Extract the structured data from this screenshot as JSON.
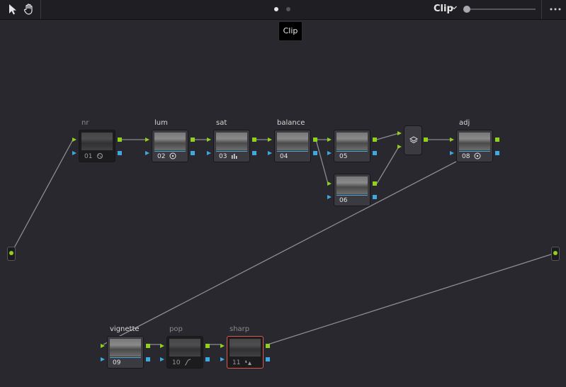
{
  "toolbar": {
    "mode_label": "Clip",
    "tools": [
      "pointer-tool",
      "hand-tool"
    ]
  },
  "tooltip": "Clip",
  "colors": {
    "rgb_port": "#8fd11c",
    "key_port": "#3fa8e0",
    "wire": "#8c8c92",
    "selected_outline": "#e0564a"
  },
  "nodes": [
    {
      "id": "01",
      "label": "nr",
      "icon": "noise-reduction-icon",
      "state": "disabled"
    },
    {
      "id": "02",
      "label": "lum",
      "icon": "color-wheels-icon",
      "state": "normal"
    },
    {
      "id": "03",
      "label": "sat",
      "icon": "levels-icon",
      "state": "normal"
    },
    {
      "id": "04",
      "label": "balance",
      "icon": "",
      "state": "normal"
    },
    {
      "id": "05",
      "label": "",
      "icon": "",
      "state": "normal"
    },
    {
      "id": "06",
      "label": "",
      "icon": "",
      "state": "normal"
    },
    {
      "id": "08",
      "label": "adj",
      "icon": "color-wheels-icon",
      "state": "normal"
    },
    {
      "id": "09",
      "label": "vignette",
      "icon": "",
      "state": "normal"
    },
    {
      "id": "10",
      "label": "pop",
      "icon": "curves-icon",
      "state": "disabled"
    },
    {
      "id": "11",
      "label": "sharp",
      "icon": "sharpen-icon",
      "state": "disabled-selected"
    }
  ],
  "layer_mixer": {
    "icon": "layer-mixer-icon"
  }
}
